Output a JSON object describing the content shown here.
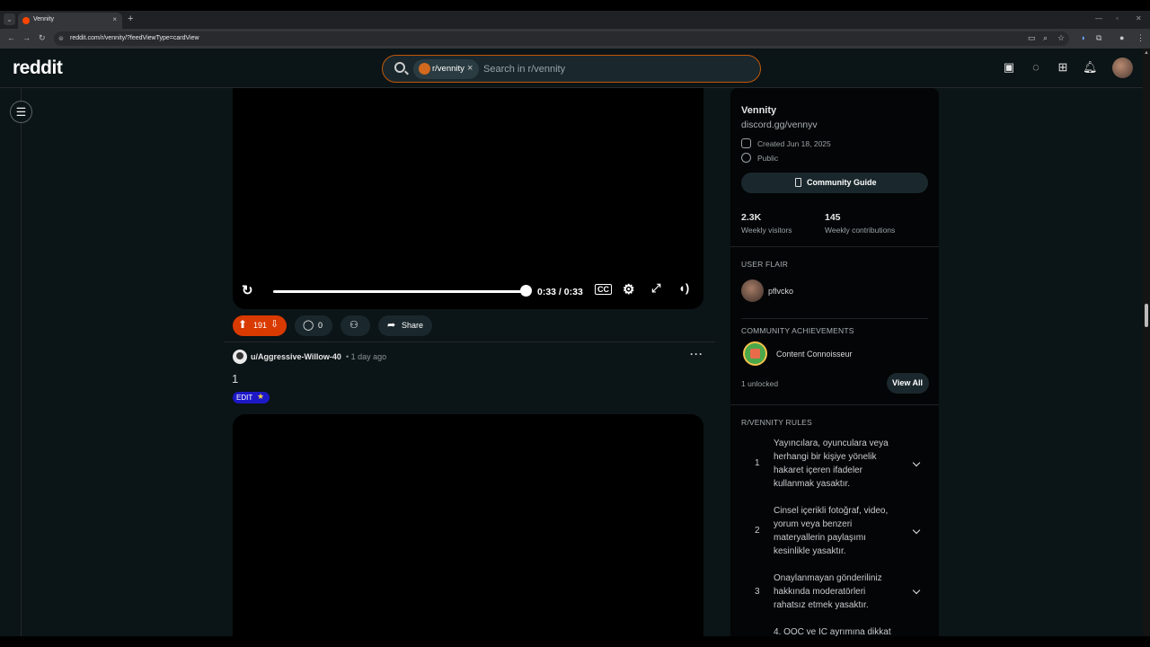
{
  "browser": {
    "tab_title": "Vennity",
    "url": "reddit.com/r/vennity/?feedViewType=cardView",
    "new_tab": "+",
    "close": "×",
    "min": "—",
    "max": "▫",
    "win_close": "✕"
  },
  "header": {
    "logo": "reddit",
    "search_chip": "r/vennity",
    "search_placeholder": "Search in r/vennity"
  },
  "video1": {
    "time": "0:33 / 0:33",
    "progress_fraction": 1.0
  },
  "post": {
    "vote_count": "191",
    "comment_count": "0",
    "share_label": "Share",
    "author": "u/Aggressive-Willow-40",
    "time": "• 1 day ago",
    "title": "1",
    "flair": "EDIT"
  },
  "sidebar": {
    "title": "Vennity",
    "subtitle": "discord.gg/vennyv",
    "created": "Created Jun 18, 2025",
    "visibility": "Public",
    "guide_button": "Community Guide",
    "stats": [
      {
        "value": "2.3K",
        "label": "Weekly visitors"
      },
      {
        "value": "145",
        "label": "Weekly contributions"
      }
    ],
    "user_flair_heading": "USER FLAIR",
    "flair_user": "pflvcko",
    "achievements_heading": "COMMUNITY ACHIEVEMENTS",
    "achievement": "Content Connoisseur",
    "unlocked": "1 unlocked",
    "view_all": "View All",
    "rules_heading": "R/VENNITY RULES",
    "rules": [
      {
        "num": "1",
        "text": "Yayıncılara, oyunculara veya herhangi bir kişiye yönelik hakaret içeren ifadeler kullanmak yasaktır."
      },
      {
        "num": "2",
        "text": "Cinsel içerikli fotoğraf, video, yorum veya benzeri materyallerin paylaşımı kesinlikle yasaktır."
      },
      {
        "num": "3",
        "text": "Onaylanmayan gönderiliniz hakkında moderatörleri rahatsız etmek yasaktır."
      },
      {
        "num": "",
        "text": "4. OOC ve IC ayrımına dikkat"
      }
    ]
  },
  "colors": {
    "accent": "#ff4500",
    "vote_bg": "#d93a00",
    "flair_bg": "#1d18c6",
    "page_bg": "#0b1416"
  }
}
